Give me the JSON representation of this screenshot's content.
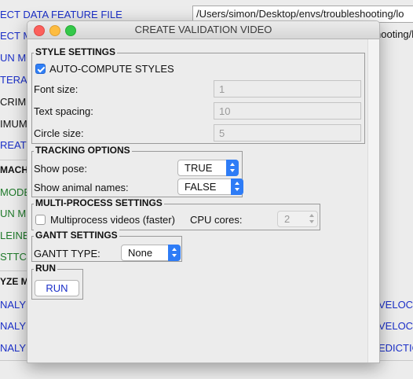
{
  "background": {
    "left_items": [
      {
        "text": "ECT DATA FEATURE FILE",
        "color": "blue"
      },
      {
        "text": "ECT M",
        "color": "blue"
      },
      {
        "text": "UN MO",
        "color": "blue"
      },
      {
        "text": "TERA",
        "color": "blue"
      },
      {
        "text": "CRIMIN",
        "color": "black"
      },
      {
        "text": "IMUM",
        "color": "black"
      },
      {
        "text": "REATE",
        "color": "blue"
      },
      {
        "text": "MACHI",
        "color": "black"
      },
      {
        "text": "MODEL",
        "color": "green"
      },
      {
        "text": "UN M",
        "color": "green"
      },
      {
        "text": "LEINB",
        "color": "green"
      },
      {
        "text": "STTC",
        "color": "green"
      },
      {
        "text": "YZE M",
        "color": "black"
      },
      {
        "text": "NALY",
        "color": "blue"
      },
      {
        "text": "NALY",
        "color": "blue"
      },
      {
        "text": "NALY",
        "color": "blue"
      }
    ],
    "path_field": "/Users/simon/Desktop/envs/troubleshooting/lo",
    "path_field_2": "hooting/lo",
    "right_items": [
      "VELOCIT",
      "VELOCIT",
      "EDICTION"
    ]
  },
  "window": {
    "title": "CREATE VALIDATION VIDEO"
  },
  "style_settings": {
    "header": "STYLE SETTINGS",
    "auto_compute_label": "AUTO-COMPUTE STYLES",
    "auto_compute_checked": true,
    "font_size_label": "Font size:",
    "font_size_value": "1",
    "text_spacing_label": "Text spacing:",
    "text_spacing_value": "10",
    "circle_size_label": "Circle size:",
    "circle_size_value": "5"
  },
  "tracking_options": {
    "header": "TRACKING OPTIONS",
    "show_pose_label": "Show pose:",
    "show_pose_value": "TRUE",
    "show_names_label": "Show animal names:",
    "show_names_value": "FALSE"
  },
  "multiprocess": {
    "header": "MULTI-PROCESS SETTINGS",
    "checkbox_label": "Multiprocess videos (faster)",
    "checked": false,
    "cores_label": "CPU cores:",
    "cores_value": "2"
  },
  "gantt": {
    "header": "GANTT SETTINGS",
    "type_label": "GANTT TYPE:",
    "type_value": "None"
  },
  "run": {
    "header": "RUN",
    "button_label": "RUN"
  },
  "colors": {
    "accent": "#2e7cf6",
    "link_blue": "#1b2fc8",
    "link_green": "#1f7a2a"
  }
}
